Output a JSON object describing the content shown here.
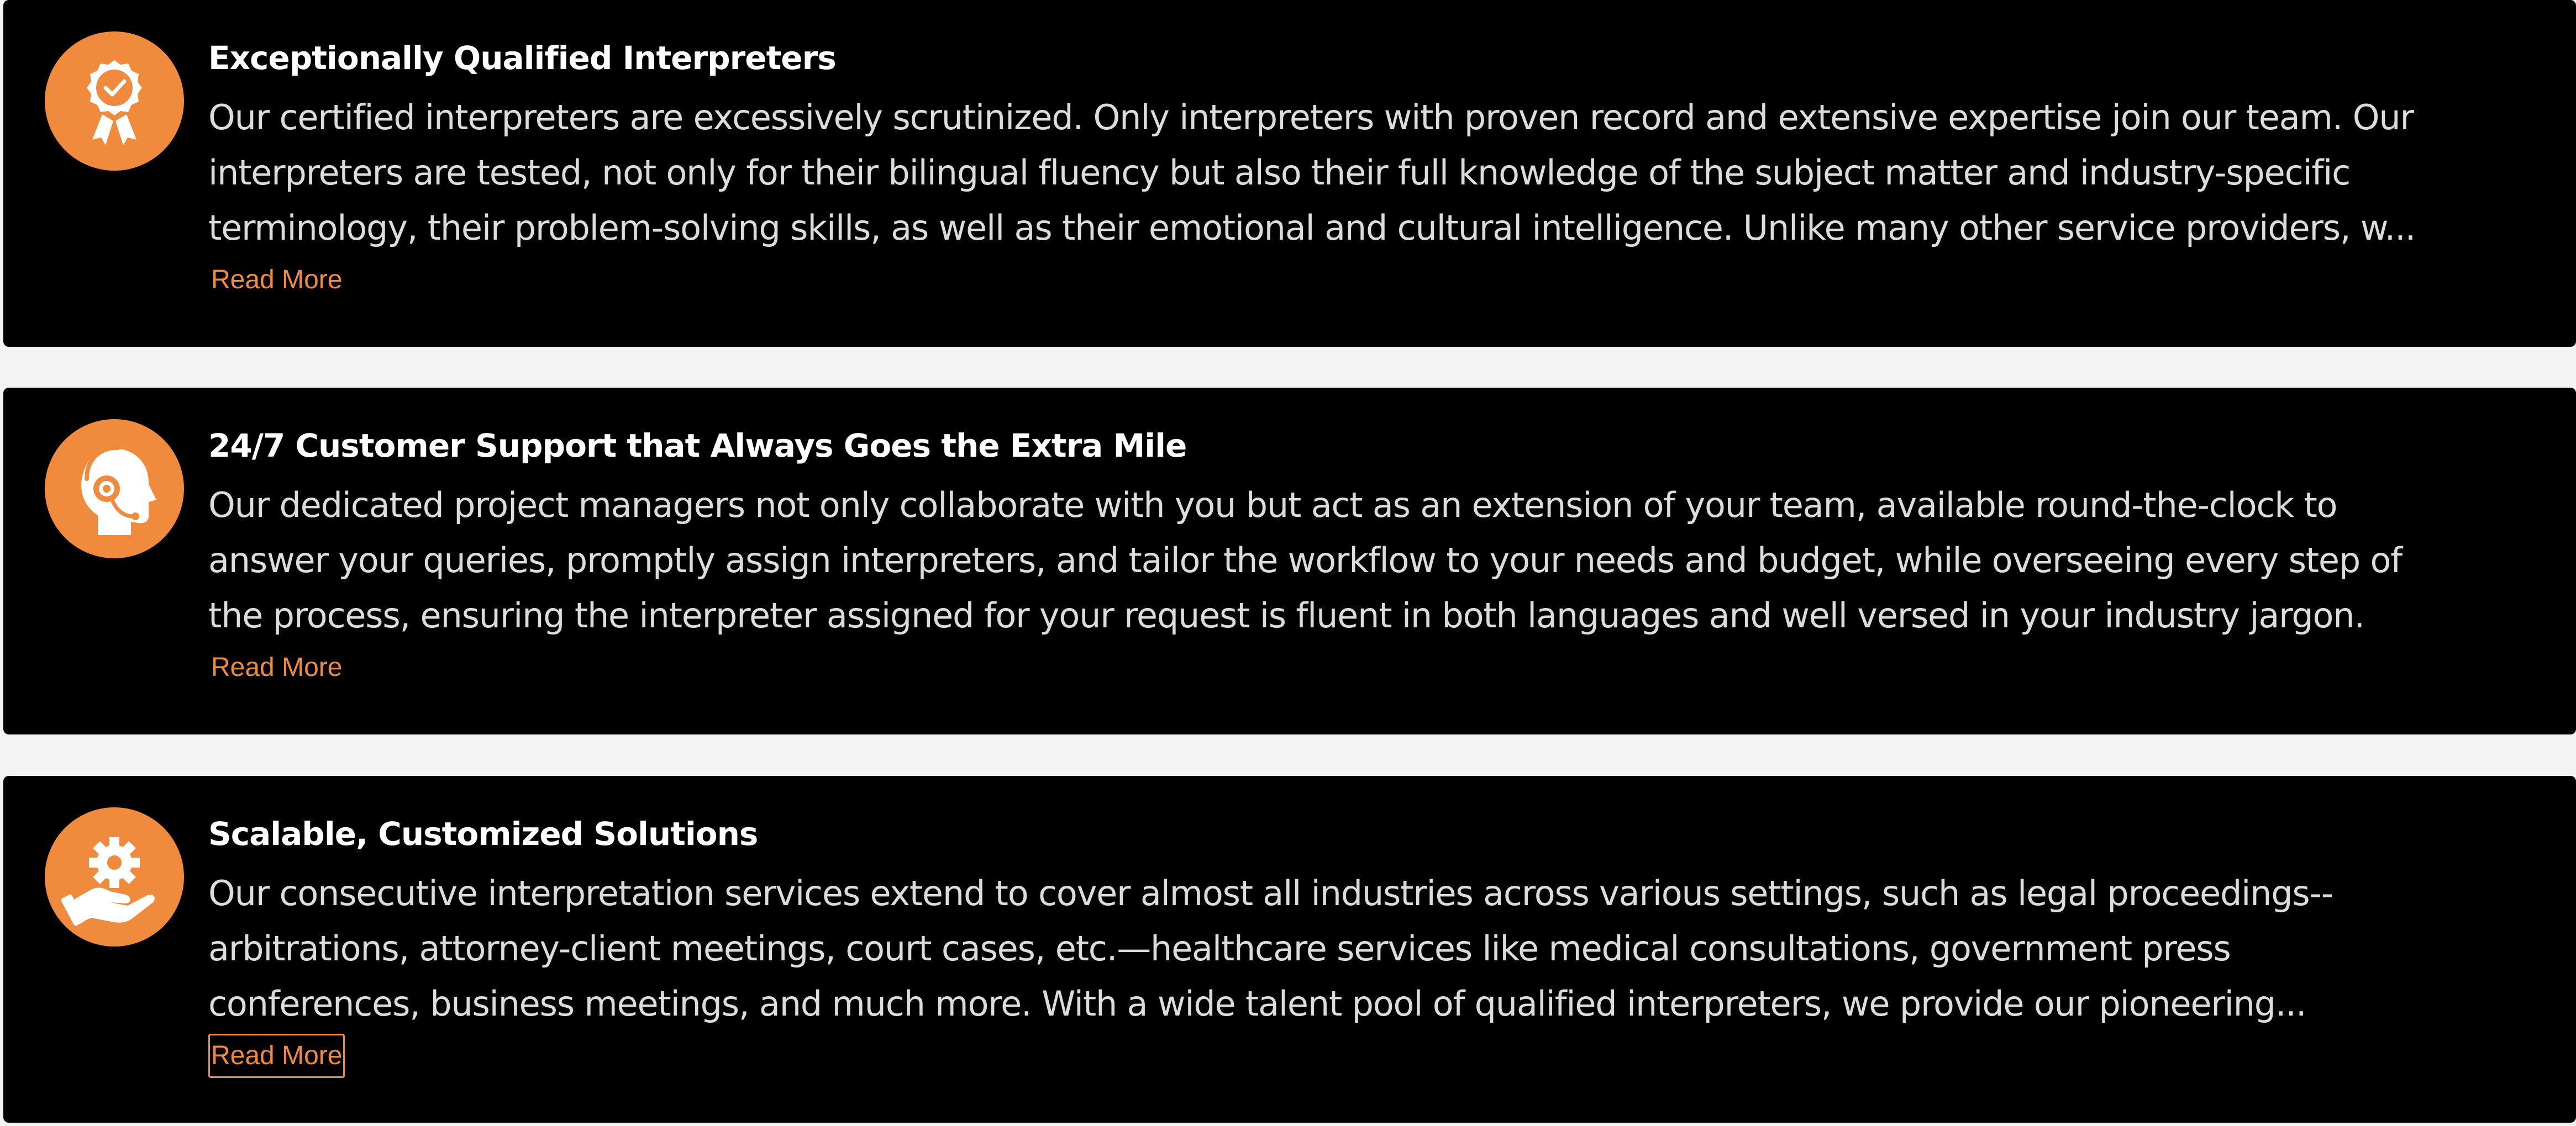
{
  "colors": {
    "accent": "#f08a3c",
    "card_background": "#000000",
    "page_background": "#f3f3f3",
    "title_text": "#ffffff",
    "body_text": "#dcdcdc"
  },
  "features": [
    {
      "icon": "award-ribbon-icon",
      "title": "Exceptionally Qualified Interpreters",
      "lines": [
        "Our certified interpreters are excessively scrutinized. Only interpreters with proven record and extensive expertise join our team. Our",
        "interpreters are tested, not only for their bilingual fluency but also their full knowledge of the subject matter and industry-specific",
        "terminology, their problem-solving skills, as well as their emotional and cultural intelligence. Unlike many other service providers, w..."
      ],
      "read_more": "Read More"
    },
    {
      "icon": "headset-support-icon",
      "title": "24/7 Customer Support that Always Goes the Extra Mile",
      "lines": [
        "Our dedicated project managers not only collaborate with you but act as an extension of your team, available round-the-clock to",
        "answer your queries, promptly assign interpreters, and tailor the workflow to your needs and budget, while overseeing every step of",
        "the process, ensuring the interpreter assigned for your request is fluent in both languages and well versed in your industry jargon."
      ],
      "read_more": "Read More"
    },
    {
      "icon": "gear-hand-icon",
      "title": "Scalable, Customized Solutions",
      "lines": [
        "Our consecutive interpretation services extend to cover almost all industries across various settings, such as legal proceedings--",
        "arbitrations, attorney-client meetings, court cases, etc.—healthcare services like medical consultations, government press",
        "conferences, business meetings, and much more. With a wide talent pool of qualified interpreters, we provide our pioneering..."
      ],
      "read_more": "Read More"
    }
  ]
}
